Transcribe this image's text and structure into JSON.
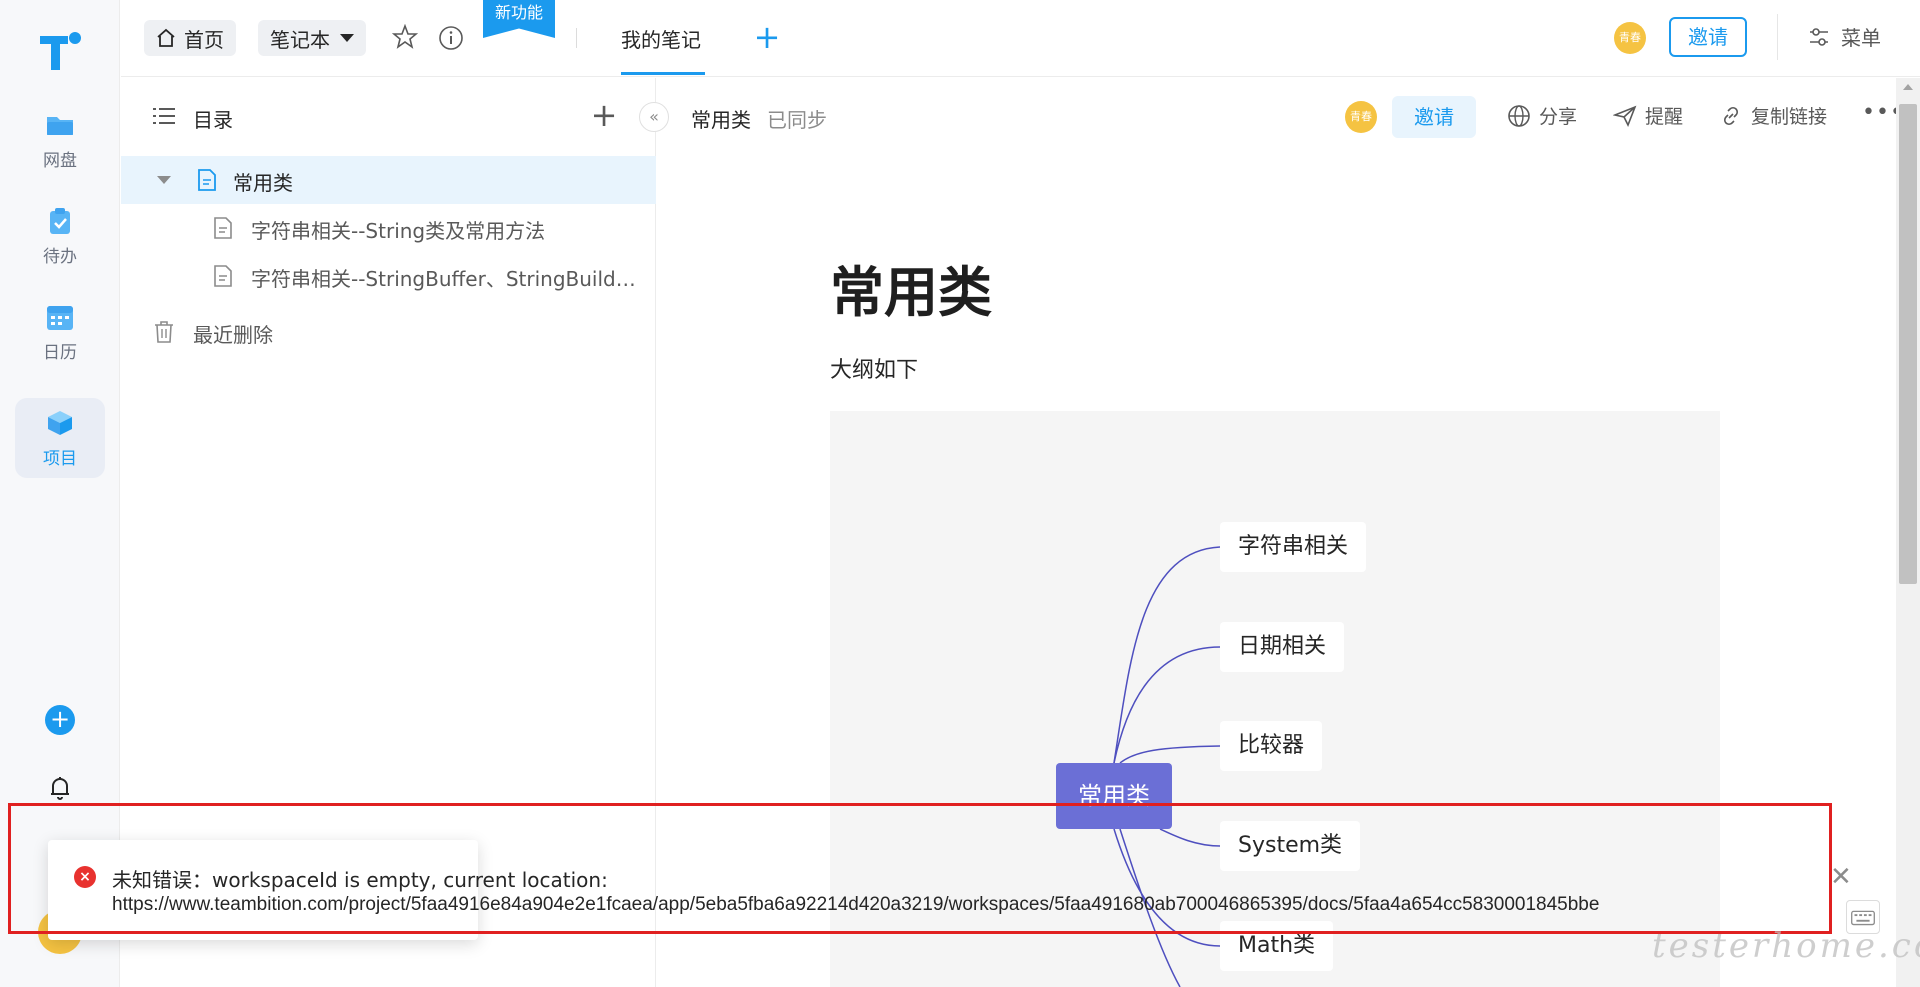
{
  "rail": {
    "items": [
      {
        "label": "网盘",
        "icon": "folder-icon"
      },
      {
        "label": "待办",
        "icon": "clipboard-check-icon"
      },
      {
        "label": "日历",
        "icon": "calendar-icon"
      },
      {
        "label": "项目",
        "icon": "cube-icon"
      }
    ],
    "add_label": "+"
  },
  "topbar": {
    "home_label": "首页",
    "notebook_label": "笔记本",
    "new_feature_label": "新功能",
    "tab_label": "我的笔记",
    "add_tab_label": "+",
    "avatar_text": "青春",
    "invite_label": "邀请",
    "menu_label": "菜单"
  },
  "sidebar": {
    "title": "目录",
    "add_label": "+",
    "collapse_label": "«",
    "tree": [
      {
        "label": "常用类",
        "level": 0,
        "selected": true
      },
      {
        "label": "字符串相关--String类及常用方法",
        "level": 1
      },
      {
        "label": "字符串相关--StringBuffer、StringBuild…",
        "level": 1
      }
    ],
    "trash_label": "最近删除"
  },
  "document": {
    "header_title": "常用类",
    "sync_status": "已同步",
    "avatar_text": "青春",
    "invite_label": "邀请",
    "actions": [
      {
        "label": "分享",
        "icon": "globe-icon"
      },
      {
        "label": "提醒",
        "icon": "send-icon"
      },
      {
        "label": "复制链接",
        "icon": "link-icon"
      }
    ],
    "more_label": "•••",
    "heading": "常用类",
    "paragraph": "大纲如下",
    "mindmap": {
      "root": "常用类",
      "nodes": [
        "字符串相关",
        "日期相关",
        "比较器",
        "System类",
        "Math类"
      ]
    }
  },
  "toast": {
    "icon_label": "×",
    "title": "未知错误：workspaceId is empty, current location:",
    "url": "https://www.teambition.com/project/5faa4916e84a904e2e1fcaea/app/5eba5fba6a92214d420a3219/workspaces/5faa491680ab700046865395/docs/5faa4a654cc5830001845bbe",
    "close_label": "✕"
  },
  "watermark": "testerhome.com",
  "colors": {
    "accent": "#1b9aee",
    "mindmap_root": "#6b6fd6",
    "error": "#e8322f",
    "highlight": "#e02020"
  }
}
